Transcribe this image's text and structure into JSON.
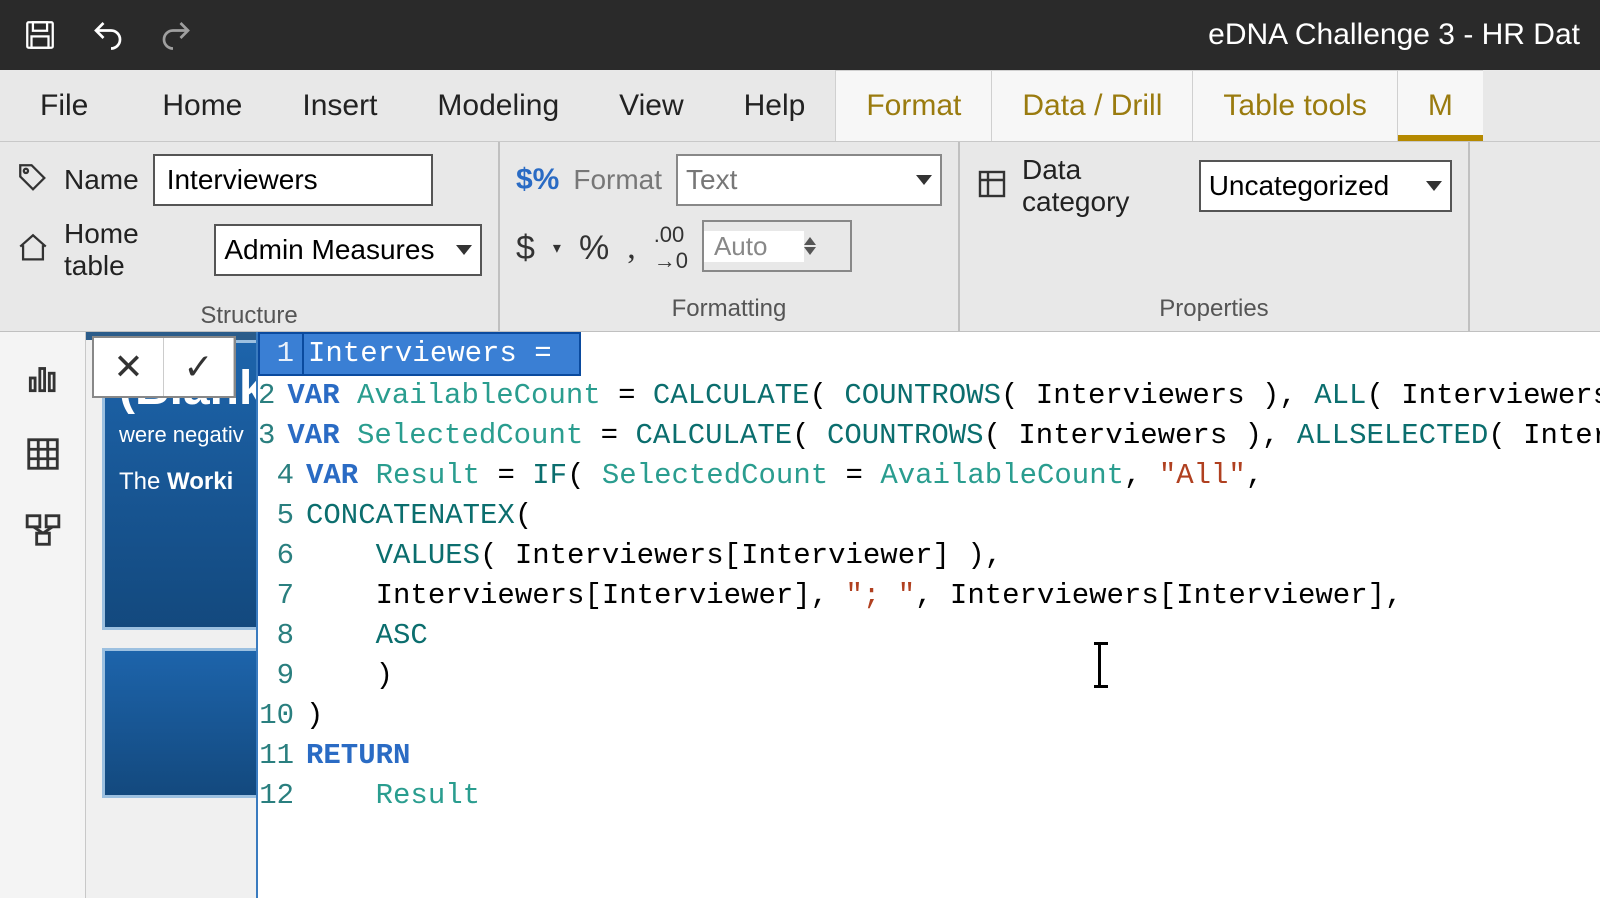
{
  "app": {
    "title": "eDNA Challenge 3 - HR Dat"
  },
  "menu": {
    "file": "File",
    "home": "Home",
    "insert": "Insert",
    "modeling": "Modeling",
    "view": "View",
    "help": "Help",
    "format": "Format",
    "data_drill": "Data / Drill",
    "table_tools": "Table tools",
    "measure_tools": "M"
  },
  "ribbon": {
    "structure": {
      "label": "Structure",
      "name_label": "Name",
      "name_value": "Interviewers",
      "home_table_label": "Home table",
      "home_table_value": "Admin Measures"
    },
    "formatting": {
      "label": "Formatting",
      "format_label": "Format",
      "format_value": "Text",
      "decimal_value": "Auto"
    },
    "properties": {
      "label": "Properties",
      "category_label": "Data category",
      "category_value": "Uncategorized"
    }
  },
  "canvas": {
    "card1_big": "(Blank)",
    "card1_line1": "were negativ",
    "card1_line2_prefix": "The ",
    "card1_line2_bold": "Worki"
  },
  "dax": {
    "lines": [
      {
        "n": "1",
        "tokens": [
          [
            "plain",
            "Interviewers = "
          ]
        ]
      },
      {
        "n": "2",
        "tokens": [
          [
            "kw",
            "VAR "
          ],
          [
            "id",
            "AvailableCount"
          ],
          [
            "plain",
            " = "
          ],
          [
            "fn",
            "CALCULATE"
          ],
          [
            "plain",
            "( "
          ],
          [
            "fn",
            "COUNTROWS"
          ],
          [
            "plain",
            "( Interviewers ), "
          ],
          [
            "fn",
            "ALL"
          ],
          [
            "plain",
            "( Interviewers ) )"
          ]
        ]
      },
      {
        "n": "3",
        "tokens": [
          [
            "kw",
            "VAR "
          ],
          [
            "id",
            "SelectedCount"
          ],
          [
            "plain",
            " = "
          ],
          [
            "fn",
            "CALCULATE"
          ],
          [
            "plain",
            "( "
          ],
          [
            "fn",
            "COUNTROWS"
          ],
          [
            "plain",
            "( Interviewers ), "
          ],
          [
            "fn",
            "ALLSELECTED"
          ],
          [
            "plain",
            "( Interviewers ) )"
          ]
        ]
      },
      {
        "n": "4",
        "tokens": [
          [
            "kw",
            "VAR "
          ],
          [
            "id",
            "Result"
          ],
          [
            "plain",
            " = "
          ],
          [
            "fn",
            "IF"
          ],
          [
            "plain",
            "( "
          ],
          [
            "id",
            "SelectedCount"
          ],
          [
            "plain",
            " = "
          ],
          [
            "id",
            "AvailableCount"
          ],
          [
            "plain",
            ", "
          ],
          [
            "str",
            "\"All\""
          ],
          [
            "plain",
            ","
          ]
        ]
      },
      {
        "n": "5",
        "tokens": [
          [
            "fn",
            "CONCATENATEX"
          ],
          [
            "plain",
            "("
          ]
        ]
      },
      {
        "n": "6",
        "tokens": [
          [
            "plain",
            "    "
          ],
          [
            "fn",
            "VALUES"
          ],
          [
            "plain",
            "( Interviewers[Interviewer] ),"
          ]
        ]
      },
      {
        "n": "7",
        "tokens": [
          [
            "plain",
            "    Interviewers[Interviewer], "
          ],
          [
            "str",
            "\"; \""
          ],
          [
            "plain",
            ", Interviewers[Interviewer],"
          ]
        ]
      },
      {
        "n": "8",
        "tokens": [
          [
            "plain",
            "    "
          ],
          [
            "fn",
            "ASC"
          ]
        ]
      },
      {
        "n": "9",
        "tokens": [
          [
            "plain",
            "    )"
          ]
        ]
      },
      {
        "n": "10",
        "tokens": [
          [
            "plain",
            ")"
          ]
        ]
      },
      {
        "n": "11",
        "tokens": [
          [
            "kw",
            "RETURN"
          ]
        ]
      },
      {
        "n": "12",
        "tokens": [
          [
            "plain",
            "    "
          ],
          [
            "id",
            "Result"
          ]
        ]
      }
    ]
  }
}
